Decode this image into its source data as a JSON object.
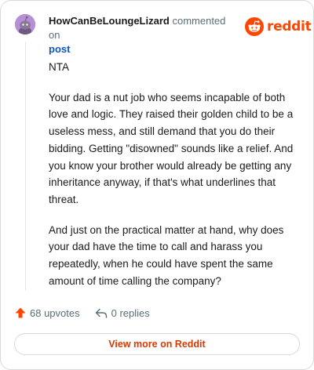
{
  "header": {
    "username": "HowCanBeLoungeLizard",
    "action_text": "commented on",
    "post_link": "post",
    "logo_word": "reddit",
    "avatar_color": "#b78fd6"
  },
  "comment": {
    "paragraphs": [
      "NTA",
      "Your dad is a nut job who seems incapable of both love and logic. They raised their golden child to be a useless mess, and still demand that you do their bidding. Getting \"disowned\" sounds like a relief. And you know your brother would already be getting any inheritance anyway, if that's what underlines that threat.",
      "And just on the practical matter at hand, why does your dad have the time to call and harass you repeatedly, when he could have spent the same amount of time calling the company?"
    ]
  },
  "actions": {
    "upvotes": "68 upvotes",
    "replies": "0 replies",
    "upvote_color": "#ff4500"
  },
  "footer": {
    "view_more": "View more on Reddit",
    "accent": "#d93a00"
  },
  "icons": {
    "avatar": "snoo-avatar-icon",
    "logo": "reddit-logo-icon",
    "upvote": "upvote-arrow-icon",
    "reply": "reply-arrow-icon"
  }
}
